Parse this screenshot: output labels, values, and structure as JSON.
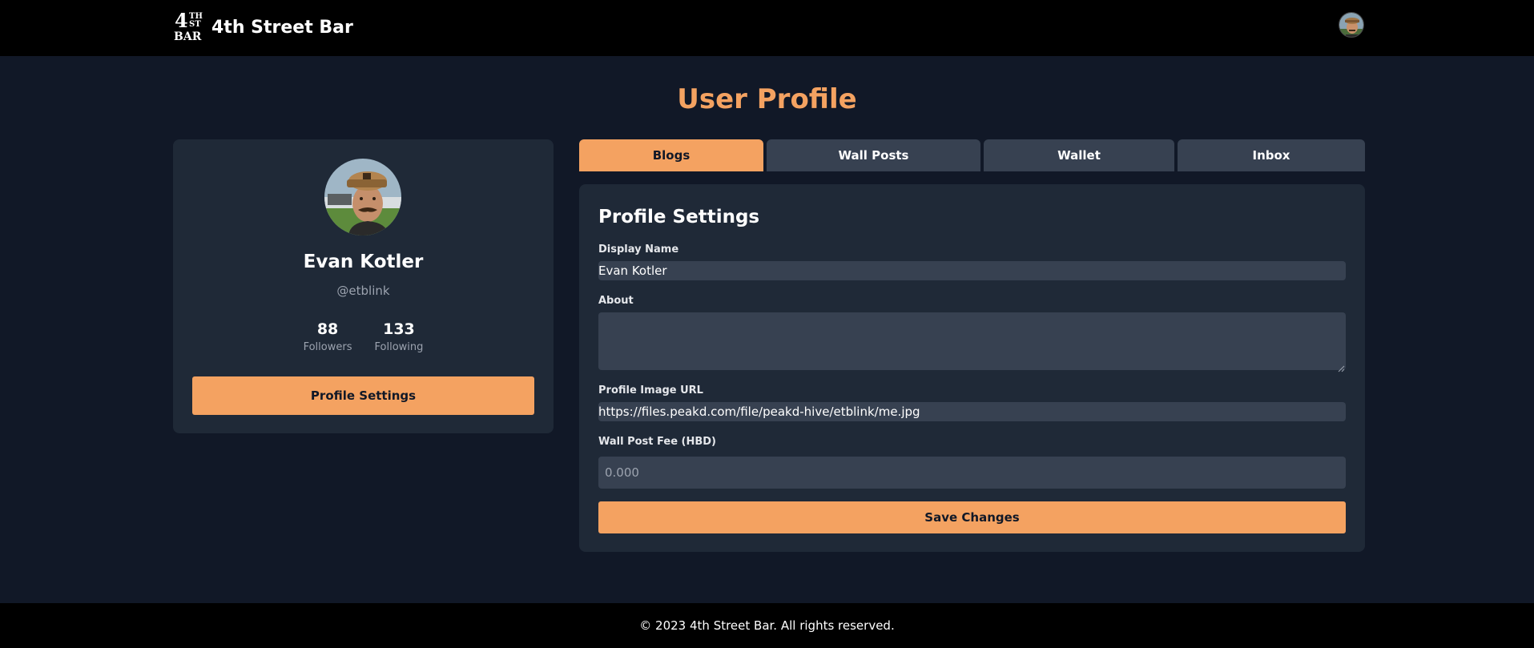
{
  "header": {
    "logo": {
      "big": "4",
      "sup1": "TH",
      "sup2": "ST",
      "bottom": "BAR"
    },
    "brand_name": "4th Street Bar"
  },
  "page": {
    "title": "User Profile"
  },
  "profile": {
    "name": "Evan Kotler",
    "handle": "@etblink",
    "followers_count": "88",
    "followers_label": "Followers",
    "following_count": "133",
    "following_label": "Following",
    "settings_button": "Profile Settings"
  },
  "tabs": [
    {
      "label": "Blogs",
      "active": true
    },
    {
      "label": "Wall Posts",
      "active": false
    },
    {
      "label": "Wallet",
      "active": false
    },
    {
      "label": "Inbox",
      "active": false
    }
  ],
  "settings": {
    "title": "Profile Settings",
    "display_name_label": "Display Name",
    "display_name_value": "Evan Kotler",
    "about_label": "About",
    "about_value": "",
    "image_url_label": "Profile Image URL",
    "image_url_value": "https://files.peakd.com/file/peakd-hive/etblink/me.jpg",
    "fee_label": "Wall Post Fee (HBD)",
    "fee_placeholder": "0.000",
    "save_button": "Save Changes"
  },
  "footer": {
    "text": "© 2023 4th Street Bar. All rights reserved."
  },
  "colors": {
    "accent": "#f4a261",
    "background": "#111827",
    "card": "#1f2937",
    "input": "#374151"
  }
}
